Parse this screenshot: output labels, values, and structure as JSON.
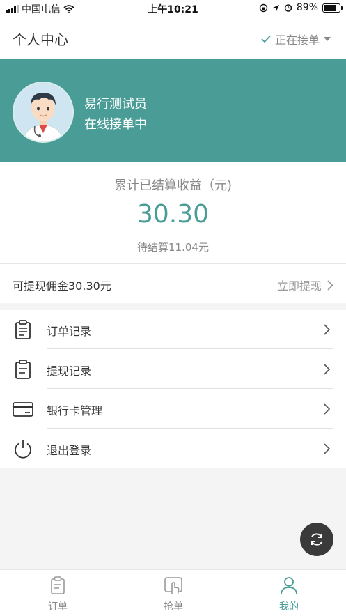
{
  "status_bar": {
    "carrier": "中国电信",
    "time": "上午10:21",
    "battery": "89%",
    "battery_level": 0.89
  },
  "header": {
    "title": "个人中心",
    "status_label": "正在接单"
  },
  "profile": {
    "name": "易行测试员",
    "status": "在线接单中"
  },
  "earnings": {
    "label": "累计已结算收益（元)",
    "amount": "30.30",
    "pending": "待结算11.04元"
  },
  "withdraw": {
    "label": "可提现佣金30.30元",
    "action": "立即提现"
  },
  "menu": {
    "items": [
      {
        "label": "订单记录",
        "icon": "clipboard-list-icon"
      },
      {
        "label": "提现记录",
        "icon": "clipboard-icon"
      },
      {
        "label": "银行卡管理",
        "icon": "bank-card-icon"
      },
      {
        "label": "退出登录",
        "icon": "power-icon"
      }
    ]
  },
  "tabs": [
    {
      "label": "订单",
      "icon": "clipboard-icon",
      "active": false
    },
    {
      "label": "抢单",
      "icon": "hand-tap-icon",
      "active": false
    },
    {
      "label": "我的",
      "icon": "user-icon",
      "active": true
    }
  ],
  "colors": {
    "accent": "#4a9d96",
    "banner": "#4a9d96",
    "fab": "#3a3a3a"
  }
}
